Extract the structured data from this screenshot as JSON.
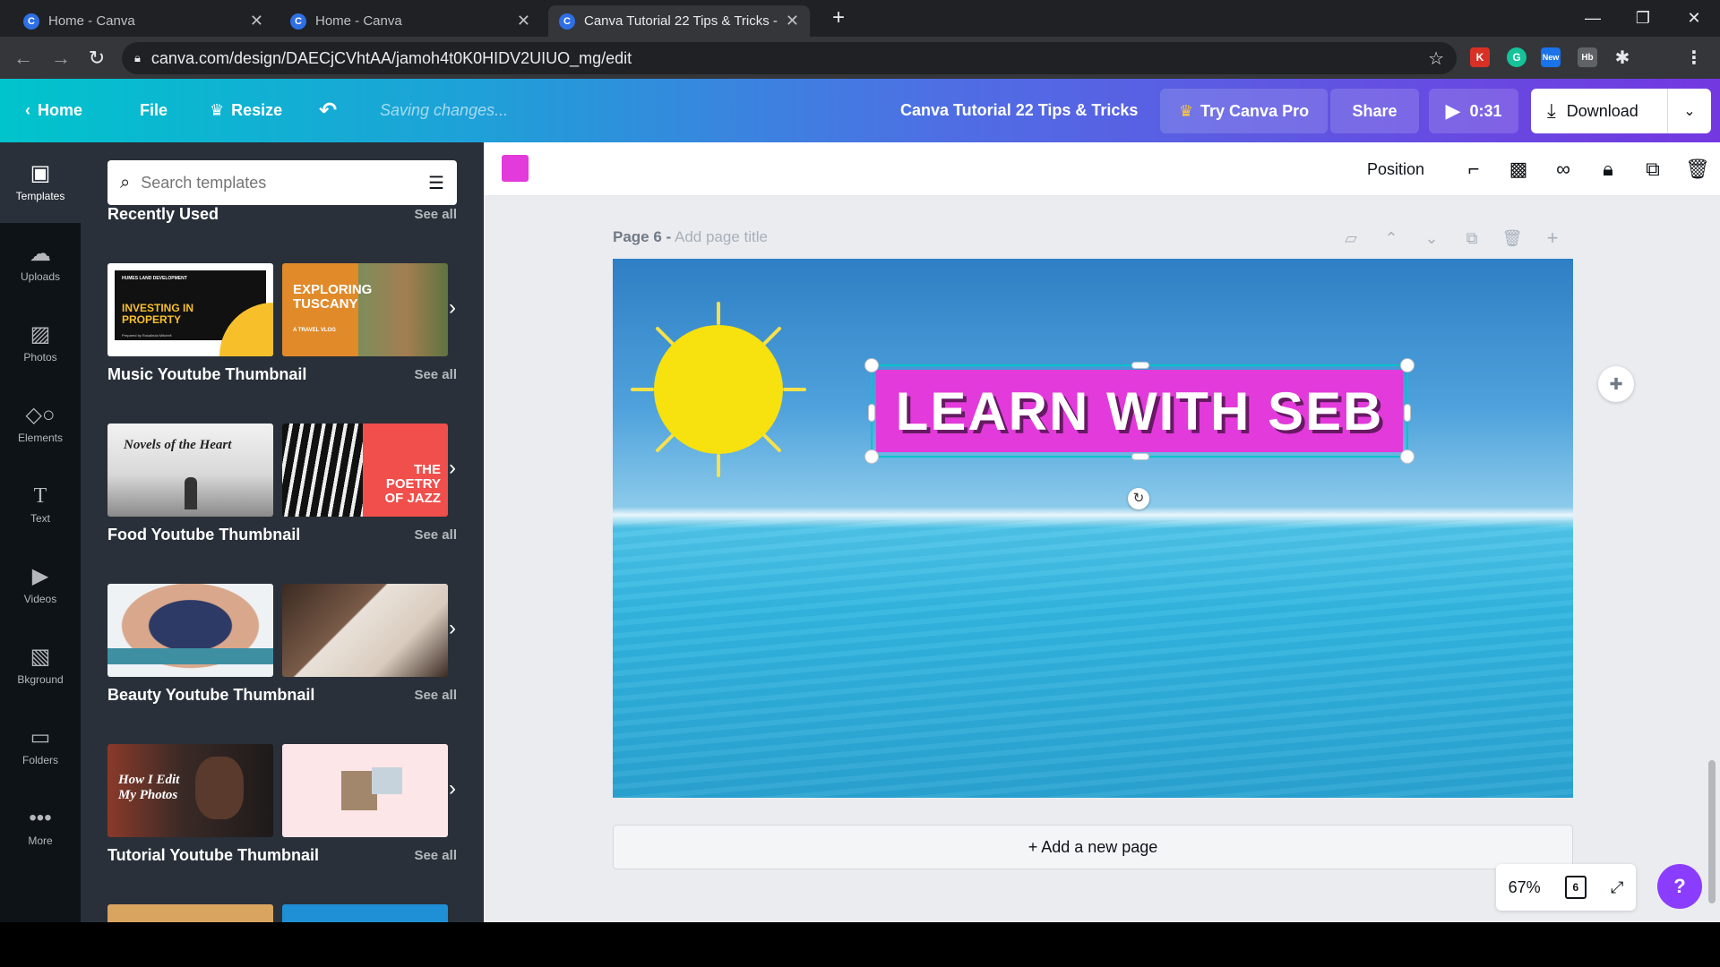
{
  "browser": {
    "tabs": [
      {
        "title": "Home - Canva",
        "active": false
      },
      {
        "title": "Home - Canva",
        "active": false
      },
      {
        "title": "Canva Tutorial 22 Tips & Tricks -",
        "active": true
      }
    ],
    "favicon_letter": "C",
    "url": "canva.com/design/DAECjCVhtAA/jamoh4t0K0HIDV2UIUO_mg/edit",
    "extensions": [
      {
        "letter": "K",
        "color": "#d93025"
      },
      {
        "letter": "G",
        "color": "#15c39a"
      },
      {
        "letter": "New",
        "color": "#1a73e8"
      },
      {
        "letter": "Hb",
        "color": "#5f6368"
      },
      {
        "letter": "",
        "color": "#8b3dff"
      }
    ]
  },
  "header": {
    "home_label": "Home",
    "file_label": "File",
    "resize_label": "Resize",
    "saving_text": "Saving changes...",
    "doc_title": "Canva Tutorial 22 Tips & Tricks",
    "try_pro_label": "Try Canva Pro",
    "share_label": "Share",
    "present_time": "0:31",
    "download_label": "Download"
  },
  "rail": {
    "items": [
      {
        "label": "Templates",
        "icon": "templates-icon"
      },
      {
        "label": "Uploads",
        "icon": "upload-icon"
      },
      {
        "label": "Photos",
        "icon": "photo-icon"
      },
      {
        "label": "Elements",
        "icon": "elements-icon"
      },
      {
        "label": "Text",
        "icon": "text-icon"
      },
      {
        "label": "Videos",
        "icon": "video-icon"
      },
      {
        "label": "Bkground",
        "icon": "background-icon"
      },
      {
        "label": "Folders",
        "icon": "folder-icon"
      },
      {
        "label": "More",
        "icon": "more-icon"
      }
    ]
  },
  "panel": {
    "search_placeholder": "Search templates",
    "see_all": "See all",
    "sections": [
      {
        "title": "Recently Used",
        "thumbs": [
          {
            "text": "INVESTING IN PROPERTY",
            "small": "HUMES LAND DEVELOPMENT",
            "footer": "Prepared by Rosalinda Mitchell"
          },
          {
            "text": "EXPLORING TUSCANY",
            "small": "A TRAVEL VLOG"
          }
        ]
      },
      {
        "title": "Music Youtube Thumbnail",
        "thumbs": [
          {
            "text": "Novels of the Heart"
          },
          {
            "text": "THE POETRY OF JAZZ"
          }
        ]
      },
      {
        "title": "Food Youtube Thumbnail",
        "thumbs": [
          {
            "text": ""
          },
          {
            "text": ""
          }
        ]
      },
      {
        "title": "Beauty Youtube Thumbnail",
        "thumbs": [
          {
            "text": "How I Edit My Photos"
          },
          {
            "text": ""
          }
        ]
      },
      {
        "title": "Tutorial Youtube Thumbnail",
        "thumbs": [
          {
            "text": ""
          },
          {
            "text": ""
          }
        ]
      }
    ]
  },
  "toolbar": {
    "color": "#e33adb",
    "position_label": "Position"
  },
  "page": {
    "label": "Page 6 -",
    "title_placeholder": "Add page title",
    "heading": "LEARN WITH SEB",
    "add_page_label": "+ Add a new page"
  },
  "footer": {
    "zoom": "67%",
    "page_count": "6",
    "help": "?"
  }
}
